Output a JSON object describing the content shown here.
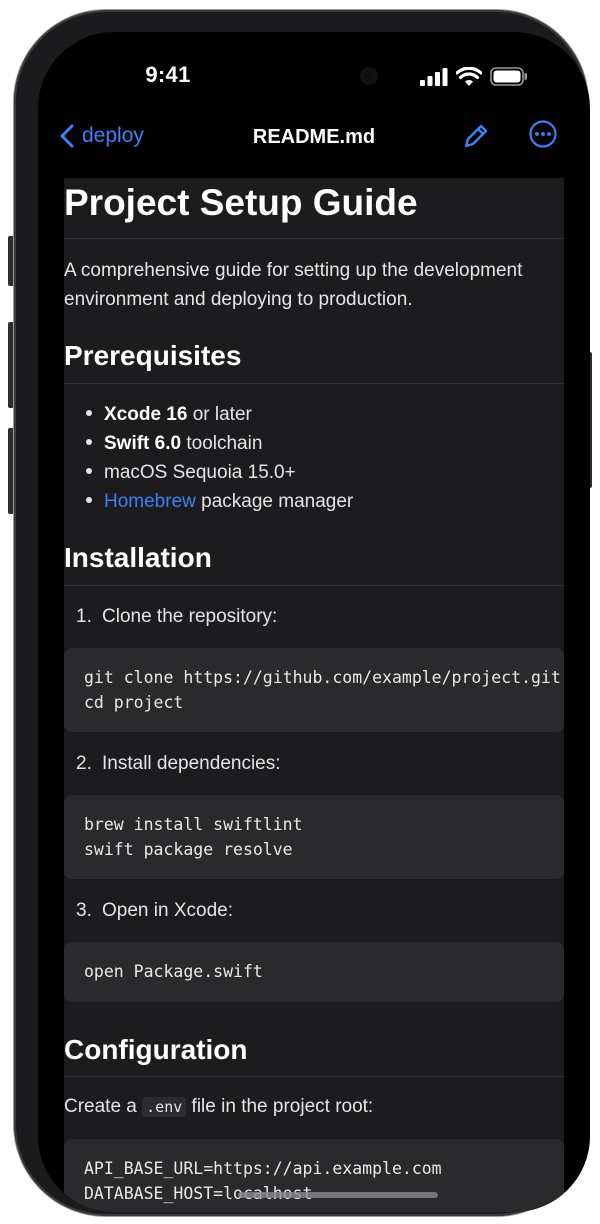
{
  "status_bar": {
    "time": "9:41"
  },
  "nav": {
    "back_label": "deploy",
    "title": "README.md"
  },
  "doc": {
    "title": "Project Setup Guide",
    "intro_line1": "A comprehensive guide for setting up the development",
    "intro_line2": "environment and deploying to production.",
    "prerequisites": {
      "heading": "Prerequisites",
      "items": [
        {
          "bold": "Xcode 16",
          "rest": " or later"
        },
        {
          "bold": "Swift 6.0",
          "rest": " toolchain"
        },
        {
          "text": "macOS Sequoia 15.0+"
        },
        {
          "link": "Homebrew",
          "rest": " package manager"
        }
      ]
    },
    "installation": {
      "heading": "Installation",
      "steps": [
        {
          "num": "1.",
          "text": "Clone the repository:",
          "code": "git clone https://github.com/example/project.git\ncd project"
        },
        {
          "num": "2.",
          "text": "Install dependencies:",
          "code": "brew install swiftlint\nswift package resolve"
        },
        {
          "num": "3.",
          "text": "Open in Xcode:",
          "code": "open Package.swift"
        }
      ]
    },
    "configuration": {
      "heading": "Configuration",
      "text_before": "Create a ",
      "inline_code": ".env",
      "text_after": " file in the project root:",
      "code": "API_BASE_URL=https://api.example.com\nDATABASE_HOST=localhost"
    }
  },
  "colors": {
    "accent": "#3b82f6",
    "content_bg": "#1c1c1e",
    "code_bg": "#2a2a2d"
  }
}
